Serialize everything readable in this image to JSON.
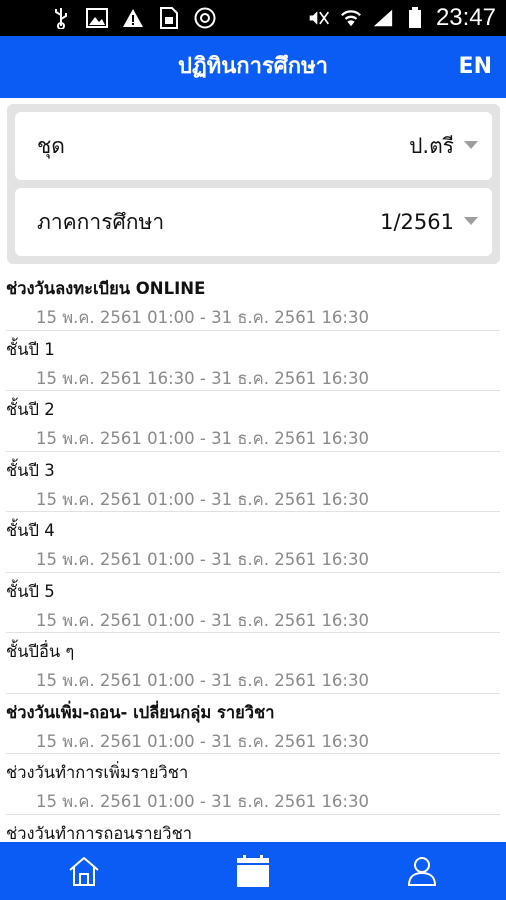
{
  "status_bar": {
    "time": "23:47",
    "icons": [
      "usb-icon",
      "image-icon",
      "warning-icon",
      "sim-icon",
      "chrome-icon",
      "mute-icon",
      "wifi-icon",
      "signal-icon",
      "battery-icon"
    ]
  },
  "app_bar": {
    "title": "ปฏิทินการศึกษา",
    "lang_button": "EN"
  },
  "filters": {
    "program": {
      "label": "ชุด",
      "value": "ป.ตรี"
    },
    "semester": {
      "label": "ภาคการศึกษา",
      "value": "1/2561"
    }
  },
  "schedule": [
    {
      "title": "ช่วงวันลงทะเบียน ONLINE",
      "range": "15 พ.ค. 2561 01:00 - 31 ธ.ค. 2561 16:30",
      "bold": true
    },
    {
      "title": "ชั้นปี 1",
      "range": "15 พ.ค. 2561 16:30 - 31 ธ.ค. 2561 16:30",
      "bold": false
    },
    {
      "title": "ชั้นปี 2",
      "range": "15 พ.ค. 2561 01:00 - 31 ธ.ค. 2561 16:30",
      "bold": false
    },
    {
      "title": "ชั้นปี 3",
      "range": "15 พ.ค. 2561 01:00 - 31 ธ.ค. 2561 16:30",
      "bold": false
    },
    {
      "title": "ชั้นปี 4",
      "range": "15 พ.ค. 2561 01:00 - 31 ธ.ค. 2561 16:30",
      "bold": false
    },
    {
      "title": "ชั้นปี 5",
      "range": "15 พ.ค. 2561 01:00 - 31 ธ.ค. 2561 16:30",
      "bold": false
    },
    {
      "title": "ชั้นปีอื่น ๆ",
      "range": "15 พ.ค. 2561 01:00 - 31 ธ.ค. 2561 16:30",
      "bold": false
    },
    {
      "title": "ช่วงวันเพิ่ม-ถอน- เปลี่ยนกลุ่ม รายวิชา",
      "range": "15 พ.ค. 2561 01:00 - 31 ธ.ค. 2561 16:30",
      "bold": true
    },
    {
      "title": "ช่วงวันทำการเพิ่มรายวิชา",
      "range": "15 พ.ค. 2561 01:00 - 31 ธ.ค. 2561 16:30",
      "bold": false
    },
    {
      "title": "ช่วงวันทำการถอนรายวิชา",
      "range": "",
      "bold": false
    }
  ],
  "bottom_nav": {
    "items": [
      "home-icon",
      "calendar-icon",
      "profile-icon"
    ],
    "active": "calendar-icon"
  },
  "colors": {
    "primary": "#0a5cf5",
    "panel": "#e3e3e3",
    "range_text": "#8a8a8a",
    "caret": "#9e9e9e"
  }
}
